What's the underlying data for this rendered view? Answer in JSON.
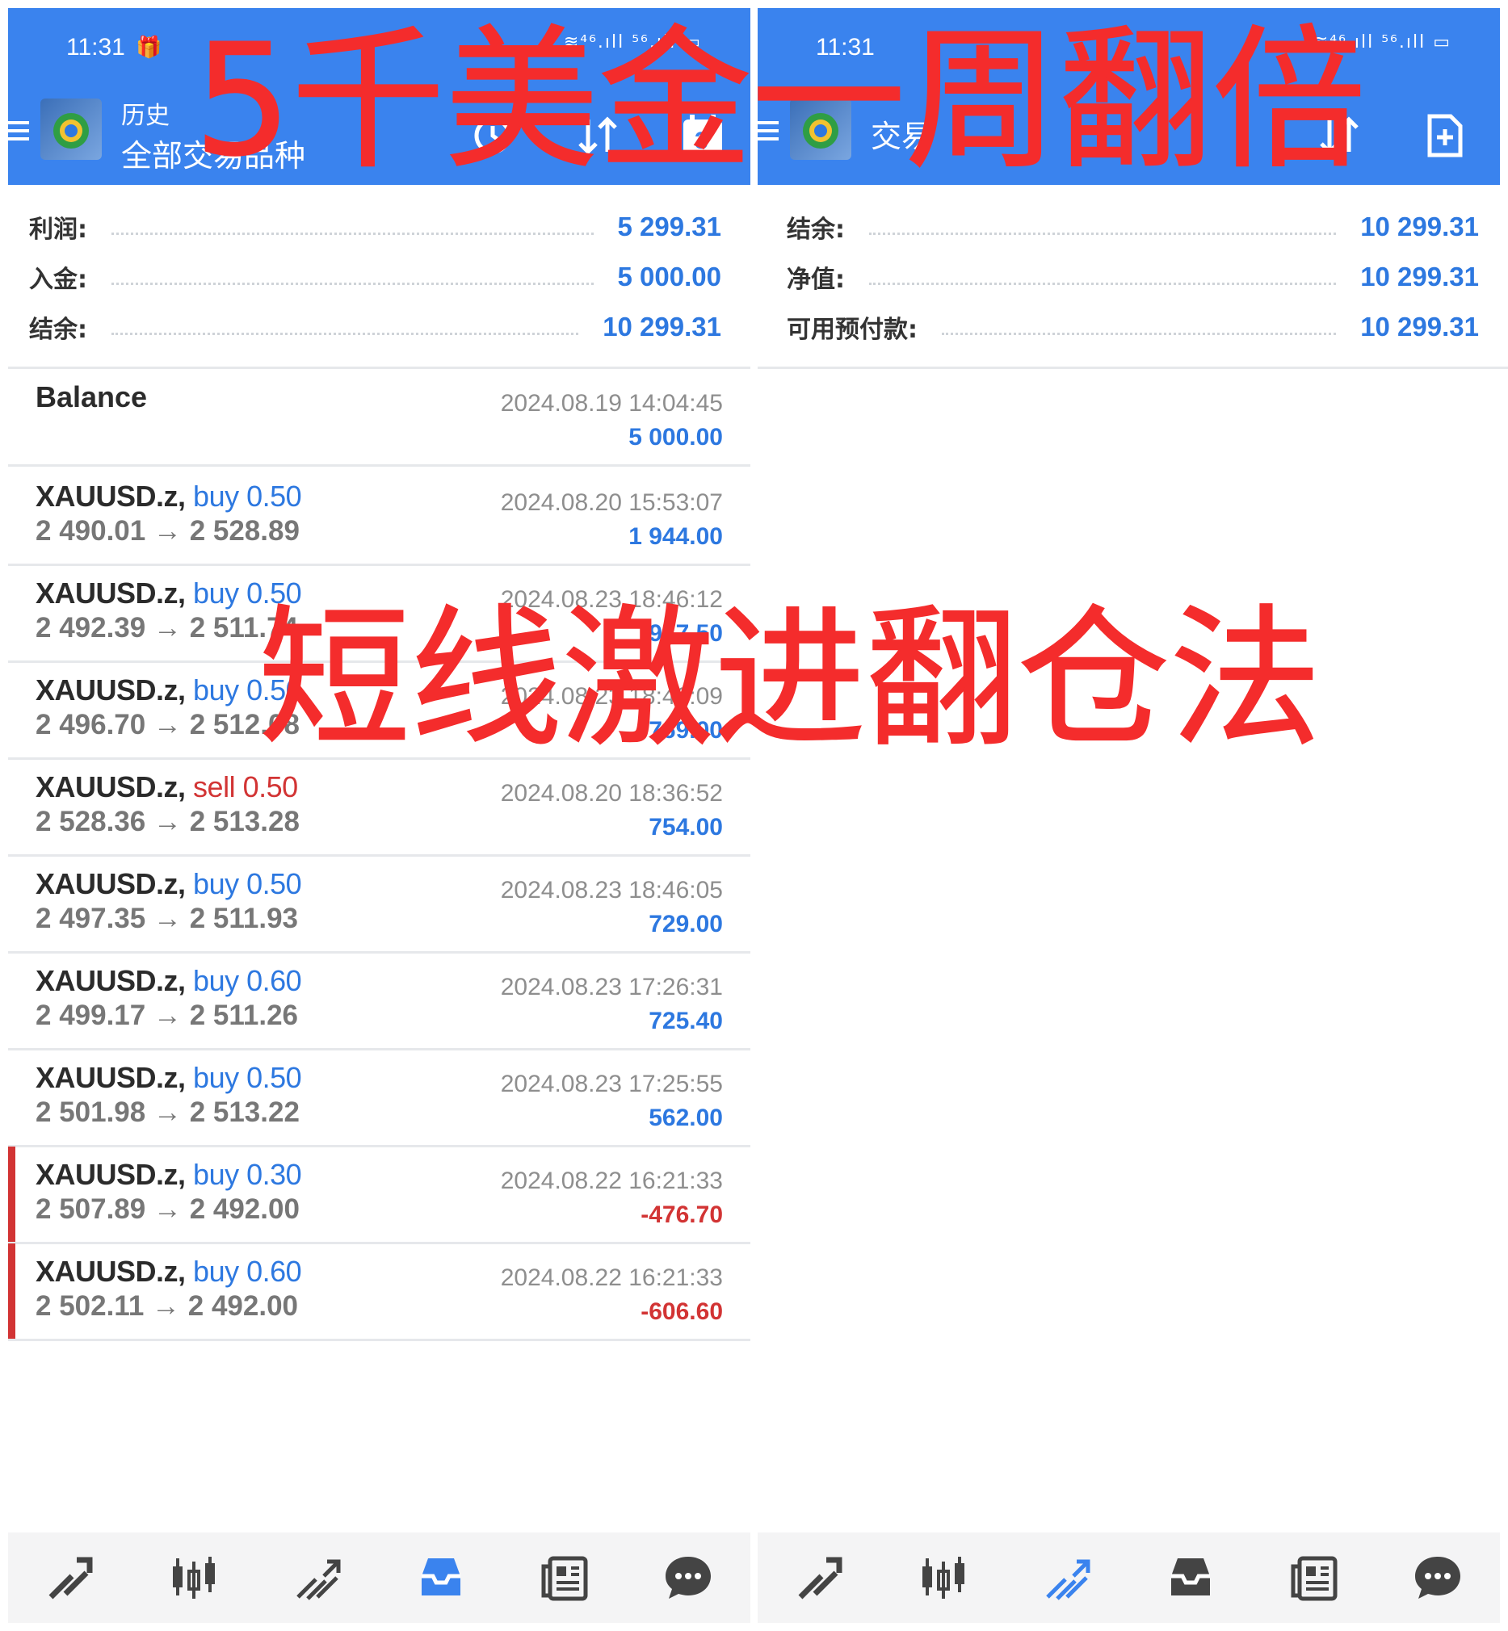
{
  "overlay": {
    "top_text": "5千美金一周翻倍",
    "middle_text": "短线激进翻仓法"
  },
  "left": {
    "status_time": "11:31",
    "status_icons": "≋⁴⁶.ıll ⁵⁶.ıll ▭",
    "header_subtitle": "历史",
    "header_title": "全部交易品种",
    "calendar_badge": "3",
    "summary": [
      {
        "label": "利润:",
        "value": "5 299.31"
      },
      {
        "label": "入金:",
        "value": "5 000.00"
      },
      {
        "label": "结余:",
        "value": "10 299.31"
      }
    ],
    "balance_entry": {
      "title": "Balance",
      "time": "2024.08.19 14:04:45",
      "amount": "5 000.00"
    },
    "deals": [
      {
        "symbol": "XAUUSD.z,",
        "side": "buy",
        "volume": "buy 0.50",
        "prices": "2 490.01 → 2 528.89",
        "time": "2024.08.20 15:53:07",
        "profit": "1 944.00"
      },
      {
        "symbol": "XAUUSD.z,",
        "side": "buy",
        "volume": "buy 0.50",
        "prices": "2 492.39 → 2 511.74",
        "time": "2024.08.23 18:46:12",
        "profit": "967.50"
      },
      {
        "symbol": "XAUUSD.z,",
        "side": "buy",
        "volume": "buy 0.50",
        "prices": "2 496.70 → 2 512.08",
        "time": "2024.08.23 18:46:09",
        "profit": "769.00"
      },
      {
        "symbol": "XAUUSD.z,",
        "side": "sell",
        "volume": "sell 0.50",
        "prices": "2 528.36 → 2 513.28",
        "time": "2024.08.20 18:36:52",
        "profit": "754.00"
      },
      {
        "symbol": "XAUUSD.z,",
        "side": "buy",
        "volume": "buy 0.50",
        "prices": "2 497.35 → 2 511.93",
        "time": "2024.08.23 18:46:05",
        "profit": "729.00"
      },
      {
        "symbol": "XAUUSD.z,",
        "side": "buy",
        "volume": "buy 0.60",
        "prices": "2 499.17 → 2 511.26",
        "time": "2024.08.23 17:26:31",
        "profit": "725.40"
      },
      {
        "symbol": "XAUUSD.z,",
        "side": "buy",
        "volume": "buy 0.50",
        "prices": "2 501.98 → 2 513.22",
        "time": "2024.08.23 17:25:55",
        "profit": "562.00"
      },
      {
        "symbol": "XAUUSD.z,",
        "side": "buy",
        "volume": "buy 0.30",
        "prices": "2 507.89 → 2 492.00",
        "time": "2024.08.22 16:21:33",
        "profit": "-476.70"
      },
      {
        "symbol": "XAUUSD.z,",
        "side": "buy",
        "volume": "buy 0.60",
        "prices": "2 502.11 → 2 492.00",
        "time": "2024.08.22 16:21:33",
        "profit": "-606.60"
      }
    ]
  },
  "right": {
    "status_time": "11:31",
    "status_icons": "≋⁴⁶.ıll ⁵⁶.ıll ▭",
    "header_title": "交易",
    "summary": [
      {
        "label": "结余:",
        "value": "10 299.31"
      },
      {
        "label": "净值:",
        "value": "10 299.31"
      },
      {
        "label": "可用预付款:",
        "value": "10 299.31"
      }
    ]
  },
  "nav_icons": [
    "quotes-icon",
    "chart-icon",
    "trade-icon",
    "history-icon",
    "news-icon",
    "messages-icon"
  ],
  "colors": {
    "header_blue": "#3a83ee",
    "profit_blue": "#2d78e0",
    "loss_red": "#d23434",
    "overlay_red": "#f42c2c"
  }
}
